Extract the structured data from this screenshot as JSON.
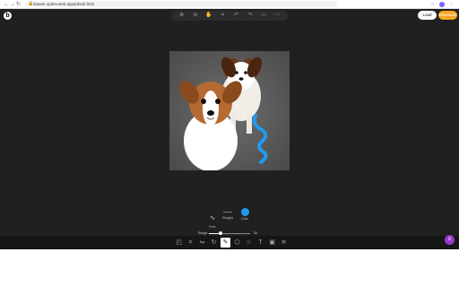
{
  "browser": {
    "nav_icons": [
      "←",
      "→",
      "↻"
    ],
    "url": "drawer.opdev.web.app/pdsub.html",
    "ext_icons": [
      "☆",
      "⋮"
    ]
  },
  "app": {
    "logo": "b",
    "top_toolbar": {
      "tools": [
        {
          "name": "zoom-in-icon",
          "glyph": "⊕"
        },
        {
          "name": "zoom-out-icon",
          "glyph": "⊖"
        },
        {
          "name": "hand-icon",
          "glyph": "✋"
        },
        {
          "name": "crop-icon",
          "glyph": "⌗"
        },
        {
          "name": "undo-icon",
          "glyph": "↶"
        },
        {
          "name": "redo-icon",
          "glyph": "↷"
        },
        {
          "name": "chat-icon",
          "glyph": "▭"
        },
        {
          "name": "more-icon",
          "glyph": "⋯"
        }
      ]
    },
    "buttons": {
      "load": "Load",
      "download": "Download"
    },
    "brush": {
      "free_label": "Free",
      "straight_label": "Straight",
      "color_label": "Color",
      "color_value": "#1e9bf0",
      "range_label": "Range",
      "range_value": "30"
    },
    "bottom_tools": [
      {
        "name": "resize-icon",
        "glyph": "◰"
      },
      {
        "name": "crop-tool-icon",
        "glyph": "⌗"
      },
      {
        "name": "flip-icon",
        "glyph": "⇋"
      },
      {
        "name": "rotate-icon",
        "glyph": "↻"
      },
      {
        "name": "draw-icon",
        "glyph": "✎",
        "active": true
      },
      {
        "name": "shape-icon",
        "glyph": "⬠"
      },
      {
        "name": "star-icon",
        "glyph": "☆"
      },
      {
        "name": "text-icon",
        "glyph": "T"
      },
      {
        "name": "image-icon",
        "glyph": "▣"
      },
      {
        "name": "filter-icon",
        "glyph": "≋"
      }
    ],
    "fab_glyph": "≡"
  }
}
